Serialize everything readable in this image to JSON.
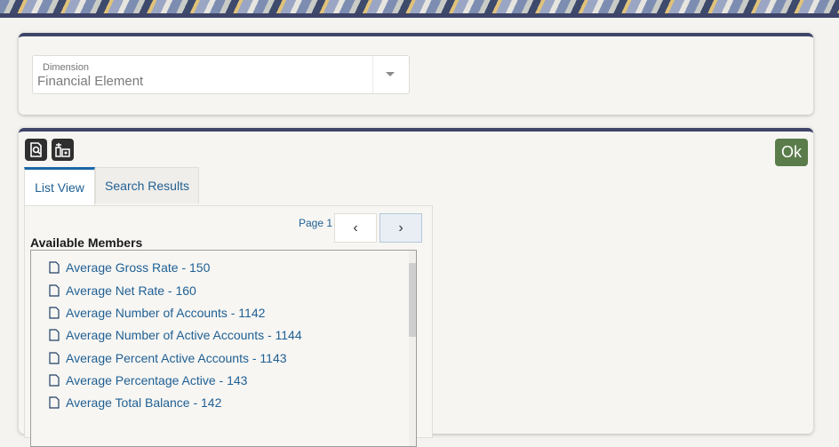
{
  "dimension": {
    "label": "Dimension",
    "value": "Financial Element"
  },
  "icons": {
    "toolbar": [
      "search-doc-icon",
      "hierarchy-icon"
    ],
    "dropdown": "caret-down-icon",
    "member": "document-icon"
  },
  "ok_label": "Ok",
  "tabs": [
    {
      "label": "List View",
      "active": true
    },
    {
      "label": "Search Results",
      "active": false
    }
  ],
  "pager": {
    "label": "Page 1",
    "prev": "‹",
    "next": "›"
  },
  "available_title": "Available Members",
  "members": [
    "Average Gross Rate - 150",
    "Average Net Rate - 160",
    "Average Number of Accounts - 1142",
    "Average Number of Active Accounts - 1144",
    "Average Percent Active Accounts - 1143",
    "Average Percentage Active - 143",
    "Average Total Balance - 142"
  ]
}
